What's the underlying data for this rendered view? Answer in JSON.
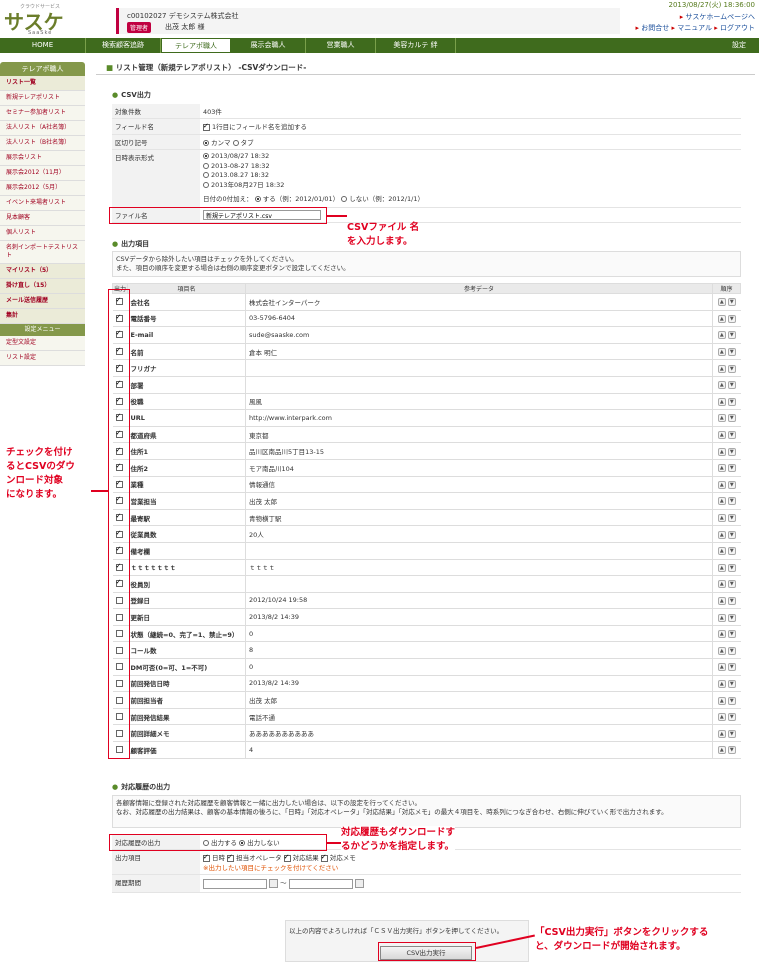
{
  "header": {
    "logo_small": "クラウドサービス",
    "logo": "サスケ",
    "logo_sub": "SaaSke",
    "account_line": "c00102027 デモシステム株式会社",
    "role_badge": "管理者",
    "user_name": "出茂 太郎 様",
    "datetime": "2013/08/27(火) 18:36:00",
    "links": [
      "サスケホームページへ",
      "お問合せ",
      "マニュアル",
      "ログアウト"
    ]
  },
  "nav": {
    "items": [
      "HOME",
      "検索顧客追跡",
      "テレアポ職人",
      "展示会職人",
      "営業職人",
      "美容カルテ 絆"
    ],
    "right": "設定"
  },
  "sidebar": {
    "title": "テレアポ職人",
    "items": [
      "リスト一覧",
      "新規テレアポリスト",
      "セミナー参加者リスト",
      "法人リスト（A社名簿）",
      "法人リスト（B社名簿）",
      "展示会リスト",
      "展示会2012（11月）",
      "展示会2012（5月）",
      "イベント来場者リスト",
      "見本顧客",
      "個人リスト",
      "名刺インポートテストリスト"
    ],
    "groups": [
      "マイリスト（5）",
      "掛け直し（15）",
      "メール送信履歴",
      "集計"
    ],
    "settings_title": "設定メニュー",
    "settings_items": [
      "定型文設定",
      "リスト設定"
    ]
  },
  "page_title": "リスト管理（新規テレアポリスト） -CSVダウンロード-",
  "csv": {
    "heading": "CSV出力",
    "rows": {
      "count_label": "対象件数",
      "count_value": "403件",
      "field_label": "フィールド名",
      "field_value": "1行目にフィールド名を追加する",
      "sep_label": "区切り記号",
      "sep_opt1": "カンマ",
      "sep_opt2": "タブ",
      "date_label": "日時表示形式",
      "date_opts": [
        "2013/08/27 18:32",
        "2013-08-27 18:32",
        "2013.08.27 18:32",
        "2013年08月27日 18:32"
      ],
      "pad_label": "日付の0付加え：",
      "pad_yes": "する（例：2012/01/01）",
      "pad_no": "しない（例：2012/1/1）",
      "file_label": "ファイル名",
      "file_value": "新規テレアポリスト.csv"
    }
  },
  "output": {
    "heading": "出力項目",
    "note1": "CSVデータから除外したい項目はチェックを外してください。",
    "note2": "また、項目の順序を変更する場合は右側の順序変更ボタンで設定してください。",
    "col_out": "出力",
    "col_name": "項目名",
    "col_ref": "参考データ",
    "col_order": "順序",
    "rows": [
      {
        "name": "会社名",
        "ref": "株式会社インターパーク",
        "on": true
      },
      {
        "name": "電話番号",
        "ref": "03-5796-6404",
        "on": true
      },
      {
        "name": "E-mail",
        "ref": "sude@saaske.com",
        "on": true
      },
      {
        "name": "名前",
        "ref": "倉本 明仁",
        "on": true
      },
      {
        "name": "フリガナ",
        "ref": "",
        "on": true
      },
      {
        "name": "部署",
        "ref": "",
        "on": true
      },
      {
        "name": "役職",
        "ref": "風風",
        "on": true
      },
      {
        "name": "URL",
        "ref": "http://www.interpark.com",
        "on": true
      },
      {
        "name": "都道府県",
        "ref": "東京都",
        "on": true
      },
      {
        "name": "住所1",
        "ref": "品川区南品川5丁目13-15",
        "on": true
      },
      {
        "name": "住所2",
        "ref": "モア南品川104",
        "on": true
      },
      {
        "name": "業種",
        "ref": "情報通信",
        "on": true
      },
      {
        "name": "営業担当",
        "ref": "出茂 太郎",
        "on": true
      },
      {
        "name": "最寄駅",
        "ref": "青物横丁駅",
        "on": true
      },
      {
        "name": "従業員数",
        "ref": "20人",
        "on": true
      },
      {
        "name": "備考欄",
        "ref": "",
        "on": true
      },
      {
        "name": "ｔｔｔｔｔｔｔ",
        "ref": "ｔｔｔｔ",
        "on": true
      },
      {
        "name": "役員別",
        "ref": "",
        "on": true
      },
      {
        "name": "登録日",
        "ref": "2012/10/24 19:58",
        "on": false
      },
      {
        "name": "更新日",
        "ref": "2013/8/2 14:39",
        "on": false
      },
      {
        "name": "状態（継続=0、完了=1、禁止=9）",
        "ref": "0",
        "on": false
      },
      {
        "name": "コール数",
        "ref": "8",
        "on": false
      },
      {
        "name": "DM可否(0=可、1=不可)",
        "ref": "0",
        "on": false
      },
      {
        "name": "前回発信日時",
        "ref": "2013/8/2 14:39",
        "on": false
      },
      {
        "name": "前回担当者",
        "ref": "出茂 太郎",
        "on": false
      },
      {
        "name": "前回発信結果",
        "ref": "電話不通",
        "on": false
      },
      {
        "name": "前回詳細メモ",
        "ref": "ああああああああああ",
        "on": false
      },
      {
        "name": "顧客評価",
        "ref": "4",
        "on": false
      }
    ]
  },
  "history": {
    "heading": "対応履歴の出力",
    "note1": "各顧客情報に登録された対応履歴を顧客情報と一緒に出力したい場合は、以下の設定を行ってください。",
    "note2": "なお、対応履歴の出力結果は、顧客の基本情報の後ろに、「日時」「対応オペレータ」「対応結果」「対応メモ」の最大４項目を、時系列につなぎ合わせ、右側に伸びていく形で出力されます。",
    "out_label": "対応履歴の出力",
    "out_yes": "出力する",
    "out_no": "出力しない",
    "items_label": "出力項目",
    "items": [
      "日時",
      "担当オペレータ",
      "対応結果",
      "対応メモ"
    ],
    "items_note": "※出力したい項目にチェックを付けてください",
    "period_label": "履歴期間",
    "tilde": "〜"
  },
  "footer": {
    "message": "以上の内容でよろしければ「ＣＳＶ出力実行」ボタンを押してください。",
    "button": "CSV出力実行"
  },
  "annotations": {
    "file": [
      "CSVファイル 名",
      "を入力します。"
    ],
    "check": [
      "チェックを付け",
      "るとCSVのダウ",
      "ンロード対象",
      "になります。"
    ],
    "history": [
      "対応履歴もダウンロードす",
      "るかどうかを指定します。"
    ],
    "exec": [
      "「CSV出力実行」ボタンをクリックする",
      "と、ダウンロードが開始されます。"
    ]
  }
}
